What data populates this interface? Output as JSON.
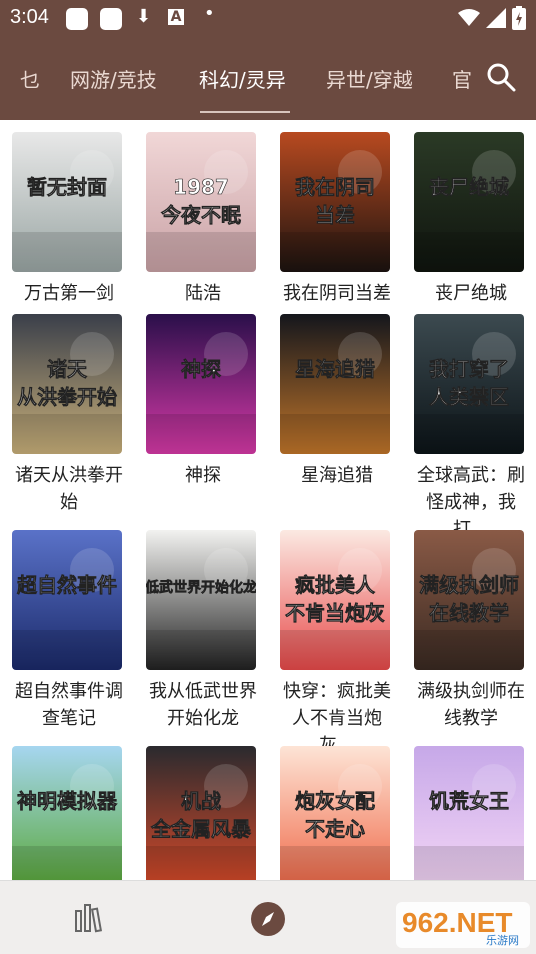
{
  "status": {
    "time": "3:04"
  },
  "tabs": [
    {
      "label": "乜"
    },
    {
      "label": "网游/竞技"
    },
    {
      "label": "科幻/灵异",
      "active": true
    },
    {
      "label": "异世/穿越"
    },
    {
      "label": "官"
    }
  ],
  "books": [
    {
      "title": "万古第一剑",
      "cover_text": "暂无封面",
      "colors": [
        "#e8e8e8",
        "#9aa6a4"
      ]
    },
    {
      "title": "陆浩",
      "cover_text": "1987 今夜不眠",
      "colors": [
        "#f1d7d7",
        "#c9a2a6"
      ]
    },
    {
      "title": "我在阴司当差",
      "cover_text": "我在阴司 当差",
      "colors": [
        "#b84a20",
        "#1c1310"
      ]
    },
    {
      "title": "丧尸绝城",
      "cover_text": "丧尸绝城",
      "colors": [
        "#2b3a26",
        "#0f140e"
      ]
    },
    {
      "title": "诸天从洪拳开始",
      "cover_text": "诸天 从洪拳开始",
      "colors": [
        "#3a3f4a",
        "#c9b07a"
      ]
    },
    {
      "title": "神探",
      "cover_text": "神探",
      "colors": [
        "#2a0f4a",
        "#d83aa8"
      ]
    },
    {
      "title": "星海追猎",
      "cover_text": "星海追猎",
      "colors": [
        "#14161c",
        "#c2762a"
      ]
    },
    {
      "title": "全球高武：刷怪成神，我打…",
      "cover_text": "我打穿了 人类禁区",
      "colors": [
        "#3c4a50",
        "#0c1418"
      ]
    },
    {
      "title": "超自然事件调查笔记",
      "cover_text": "超自然事件",
      "colors": [
        "#5a72c8",
        "#1b2a6a"
      ]
    },
    {
      "title": "我从低武世界开始化龙",
      "cover_text": "低武世界开始化龙",
      "colors": [
        "#f2f2f0",
        "#222222"
      ]
    },
    {
      "title": "快穿：疯批美人不肯当炮灰…",
      "cover_text": "疯批美人 不肯当炮灰",
      "colors": [
        "#fbe9e2",
        "#e84a4a"
      ]
    },
    {
      "title": "满级执剑师在线教学",
      "cover_text": "满级执剑师 在线教学",
      "colors": [
        "#8a5a46",
        "#3a2a22"
      ]
    },
    {
      "title": "",
      "cover_text": "神明模拟器",
      "colors": [
        "#a6d6f0",
        "#5aa83a"
      ]
    },
    {
      "title": "",
      "cover_text": "机战 全金属风暴",
      "colors": [
        "#2a2a2e",
        "#d84a2a"
      ]
    },
    {
      "title": "",
      "cover_text": "炮灰女配 不走心",
      "colors": [
        "#fde4d6",
        "#f06a4a"
      ]
    },
    {
      "title": "",
      "cover_text": "饥荒女王",
      "colors": [
        "#c6a8e8",
        "#f4d6f6"
      ]
    }
  ],
  "watermark": {
    "text": "962.NET",
    "sub": "乐游网"
  }
}
